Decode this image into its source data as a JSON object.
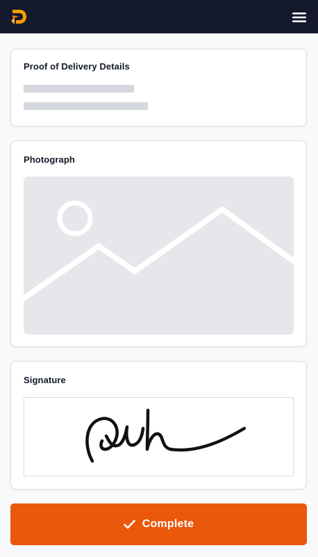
{
  "header": {
    "logo_icon": "brand-logo-icon",
    "menu_icon": "hamburger-menu-icon",
    "background_color": "#141a2b"
  },
  "delivery_details": {
    "title": "Proof of Delivery Details"
  },
  "photograph": {
    "title": "Photograph",
    "placeholder_icon": "image-placeholder-icon"
  },
  "signature": {
    "title": "Signature"
  },
  "actions": {
    "complete_label": "Complete",
    "complete_icon": "check-icon",
    "accent_color": "#ea580c"
  }
}
